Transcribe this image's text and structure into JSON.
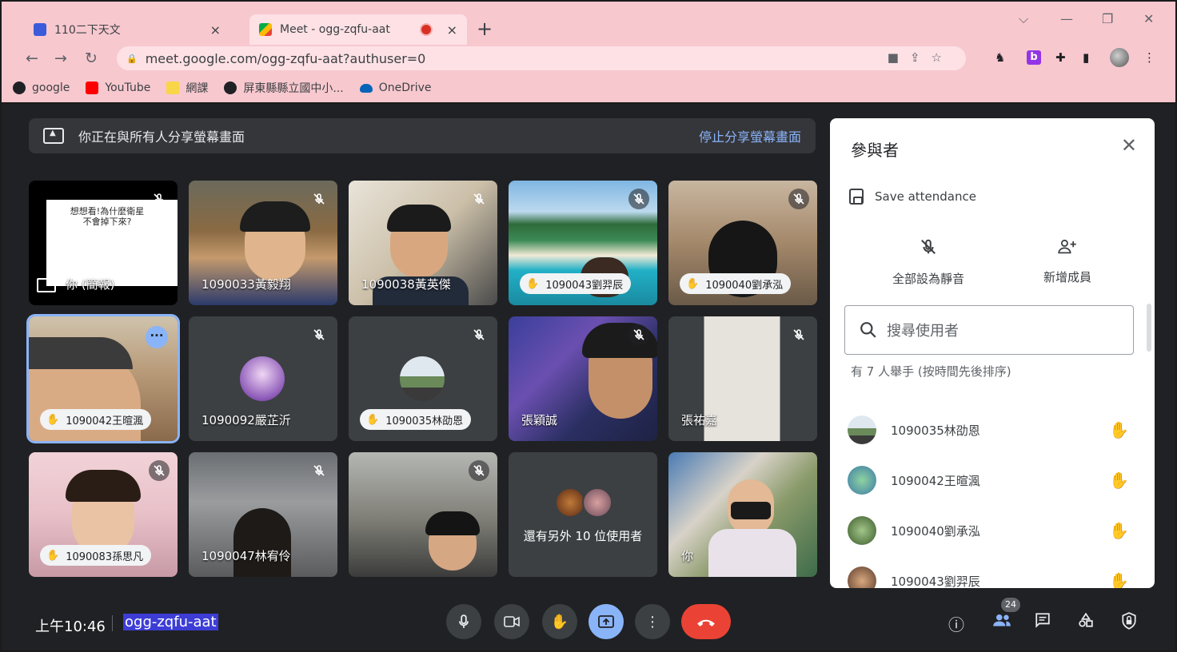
{
  "browser": {
    "tabs": [
      {
        "title": "110二下天文",
        "close": "×"
      },
      {
        "title": "Meet - ogg-zqfu-aat",
        "close": "×"
      }
    ],
    "new_tab": "+",
    "address": "meet.google.com/ogg-zqfu-aat?authuser=0",
    "extension_b": "b",
    "bookmarks": [
      {
        "label": "google",
        "icon": "globe-icon"
      },
      {
        "label": "YouTube",
        "icon": "youtube-icon",
        "color": "#ff0000"
      },
      {
        "label": "網課",
        "icon": "folder-icon",
        "color": "#f9d548"
      },
      {
        "label": "屏東縣縣立國中小...",
        "icon": "globe-icon"
      },
      {
        "label": "OneDrive",
        "icon": "cloud-icon",
        "color": "#0364b8"
      }
    ],
    "chrome_color": "#f8c8cf"
  },
  "meet": {
    "share_banner": {
      "text": "你正在與所有人分享螢幕畫面",
      "stop": "停止分享螢幕畫面"
    },
    "tiles": [
      {
        "name": "你 (簡報)",
        "style": "slide",
        "slide_text": "想想看!為什麼衛星不會掉下來?"
      },
      {
        "name": "1090033黃毅翔",
        "style": "plain"
      },
      {
        "name": "1090038黃英傑",
        "style": "plain"
      },
      {
        "name": "1090043劉羿辰",
        "style": "pill",
        "hand": true
      },
      {
        "name": "1090040劉承泓",
        "style": "pill",
        "hand": true
      },
      {
        "name": "1090042王暄渢",
        "style": "pill",
        "hand": true,
        "highlighted": true
      },
      {
        "name": "1090092嚴芷沂",
        "style": "avatar"
      },
      {
        "name": "1090035林劭恩",
        "style": "pill-avatar",
        "hand": true
      },
      {
        "name": "張穎誠",
        "style": "plain"
      },
      {
        "name": "張祐嘉",
        "style": "plain"
      },
      {
        "name": "1090083孫思凡",
        "style": "pill",
        "hand": true
      },
      {
        "name": "1090047林宥伶",
        "style": "plain"
      },
      {
        "name": "",
        "style": "plain"
      },
      {
        "name": "還有另外 10 位使用者",
        "style": "others"
      },
      {
        "name": "你",
        "style": "plain"
      }
    ],
    "more_options": "···",
    "panel": {
      "title": "參與者",
      "save_attendance": "Save attendance",
      "mute_all": "全部設為靜音",
      "add_member": "新增成員",
      "search_placeholder": "搜尋使用者",
      "raised_hands_label": "有 7 人舉手 (按時間先後排序)",
      "people": [
        {
          "name": "1090035林劭恩"
        },
        {
          "name": "1090042王暄渢"
        },
        {
          "name": "1090040劉承泓"
        },
        {
          "name": "1090043劉羿辰"
        }
      ]
    },
    "bottom": {
      "time": "上午10:46",
      "meeting_code": "ogg-zqfu-aat",
      "participant_count": "24"
    },
    "accent": "#8ab4f8",
    "end_call_color": "#ea4335"
  }
}
